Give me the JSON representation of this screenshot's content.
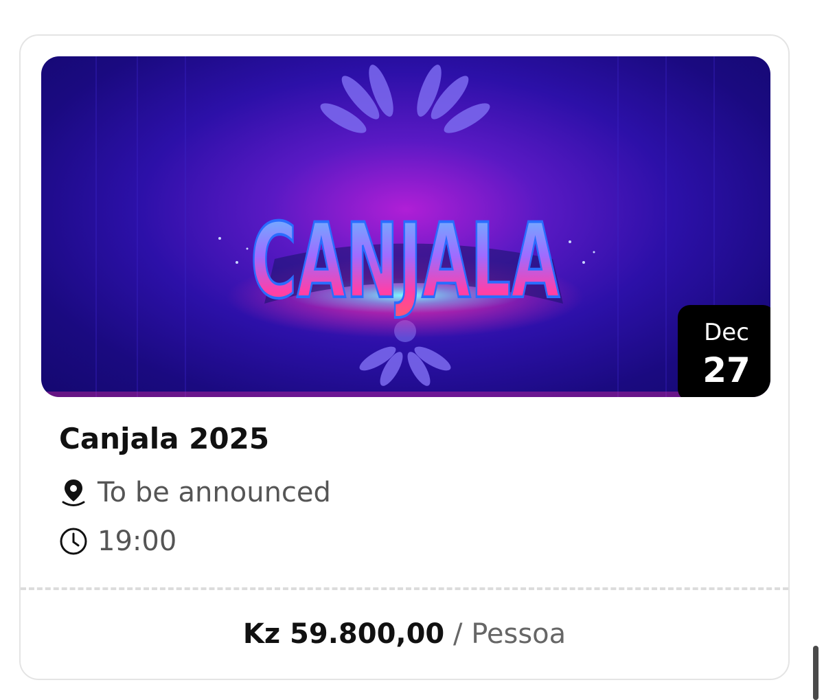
{
  "event": {
    "banner_logo_text": "CANJALA",
    "date_month": "Dec",
    "date_day": "27",
    "title": "Canjala 2025",
    "location": "To be announced",
    "time": "19:00",
    "price_amount": "Kz 59.800,00",
    "price_separator": "/",
    "price_unit": "Pessoa"
  },
  "icons": {
    "location": "location-pin-icon",
    "time": "clock-icon"
  },
  "colors": {
    "banner_bg": "#1a0a80",
    "badge_bg": "#000000",
    "card_border": "#e4e4e4"
  }
}
